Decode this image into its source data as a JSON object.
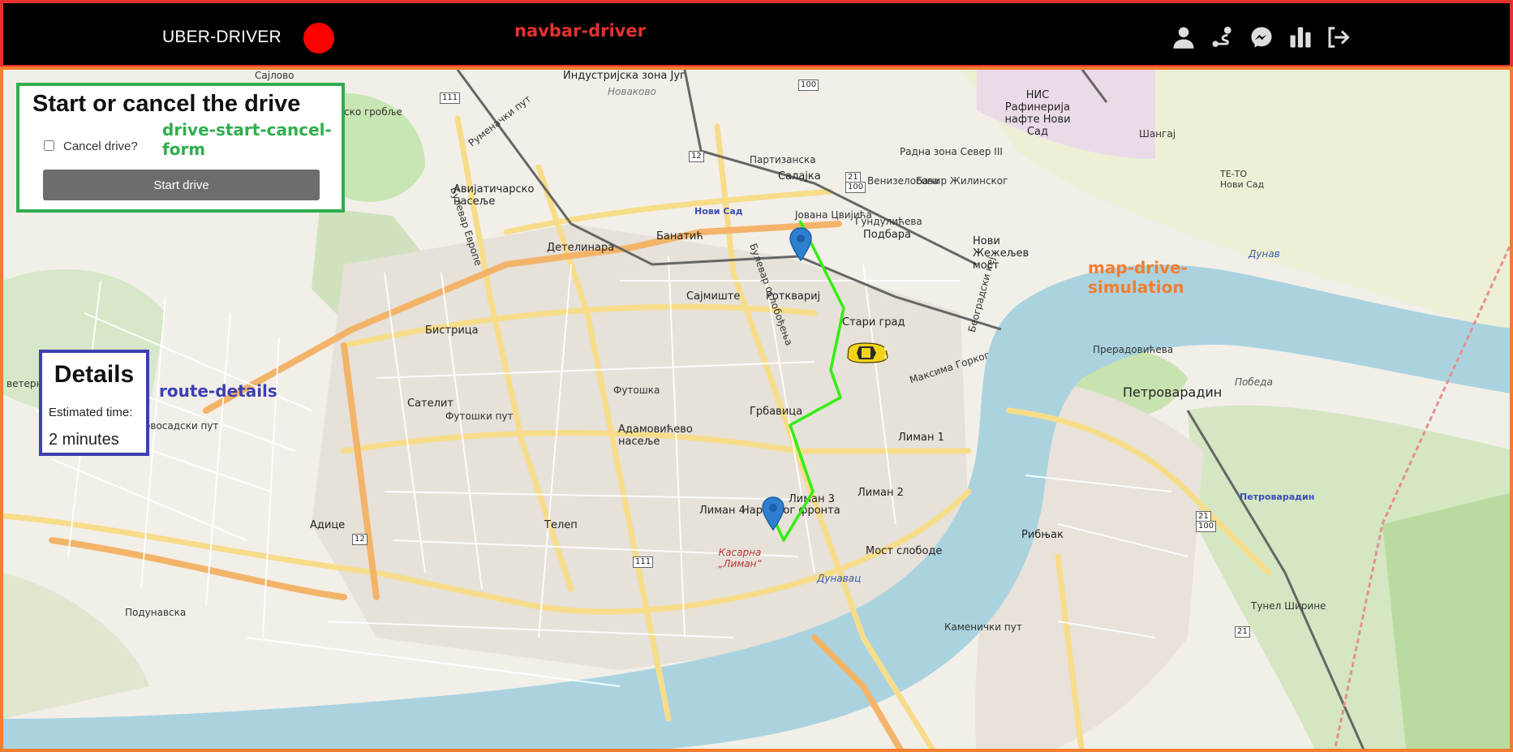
{
  "navbar": {
    "brand": "UBER-DRIVER",
    "tag": "navbar-driver",
    "status_color": "#ff0000",
    "icons": [
      "user-icon",
      "route-icon",
      "messenger-icon",
      "bar-chart-icon",
      "logout-icon"
    ]
  },
  "drive_form": {
    "title": "Start or cancel the drive",
    "tag": "drive-start-cancel-form",
    "cancel_label": "Cancel drive?",
    "cancel_checked": false,
    "start_label": "Start drive"
  },
  "details": {
    "title": "Details",
    "tag": "route-details",
    "estimated_time_label": "Estimated time:",
    "estimated_time_value": "2 minutes"
  },
  "map": {
    "tag": "map-drive-simulation",
    "labels": {
      "industrial": "Индустријска зона Југ",
      "novakovo": "Новаково",
      "partizanska": "Партизанска",
      "salajka": "Салајка",
      "radna_zona": "Радна зона Север III",
      "bacir": "Бачир Жилинског",
      "venizelosova": "Венизелосова",
      "nis": "НИС Рафинерија нафте Нови Сад",
      "shangaj": "Шангај",
      "te_to": "ТЕ-ТО Нови Сад",
      "aviaticarsko": "Авијатичарско насеље",
      "bulevar_evrope": "Булевар Европе",
      "novi_sad_station": "Нови Сад",
      "jovana_cvijica": "Јована Цвијића",
      "gundulica": "Гундулићева",
      "podbara": "Подбара",
      "novi_zezelj": "Нови Жежељев мост",
      "detelinara": "Детелинара",
      "banatic": "Банатић",
      "rotkvarija": "Ротквариј",
      "sajmiste": "Сајмиште",
      "stari_grad": "Стари град",
      "bistrica": "Бистрица",
      "futoska": "Футошка",
      "satelit": "Сателит",
      "futoski_put": "Футошки пут",
      "grbavica": "Грбавица",
      "adamovicevo": "Адамовићево насеље",
      "liman1": "Лиман 1",
      "liman2": "Лиман 2",
      "liman3": "Лиман 3",
      "liman4": "Лиман 4",
      "narodnog_fronta": "Народног фронта",
      "telep": "Телеп",
      "adice": "Адице",
      "most_slobode": "Мост слободе",
      "kasarna": "Касарна „Лиман“",
      "dunavac": "Дунавац",
      "petrovaradin": "Петроварадин",
      "petrovaradin_station": "Петроварадин",
      "ribnjak": "Рибњак",
      "pobeda": "Победа",
      "preradoviceva": "Прерадовићева",
      "dunav": "Дунав",
      "novosadski_put": "Новосадски пут",
      "sajlovo": "Сајлово",
      "groblje": "ско гробље",
      "veternik": "ветерник",
      "podunavska": "Подунавска",
      "kamenicki_put": "Каменички пут",
      "tunel": "Тунел Ширине",
      "rumenacki": "Руменачки пут",
      "bulevar_oslobodjenja": "Булевар ослобођења",
      "maksima_gorkog": "Максима Горког",
      "beogradski_kej": "Београдски кеј"
    },
    "shields": [
      "111",
      "100",
      "12",
      "21",
      "100",
      "12",
      "111",
      "21",
      "100",
      "21"
    ],
    "route": {
      "color": "#33ee11",
      "start_marker": "map-pin-icon",
      "end_marker": "map-pin-icon",
      "vehicle": "taxi-car-icon"
    }
  }
}
